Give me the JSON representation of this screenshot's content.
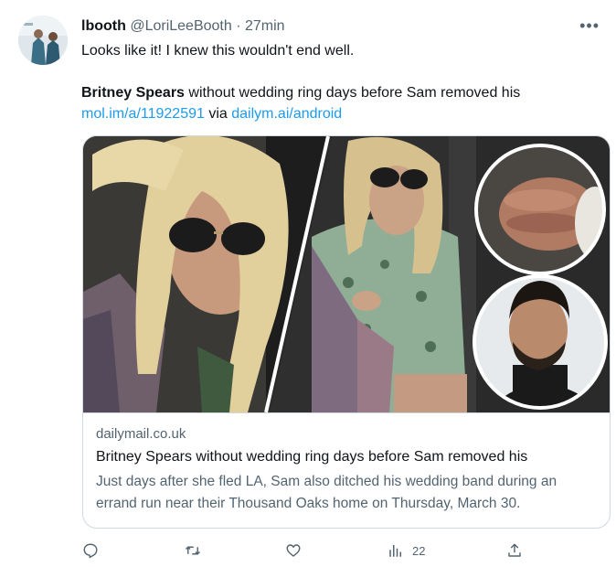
{
  "author": {
    "display_name": "lbooth",
    "handle": "@LoriLeeBooth",
    "separator": "·",
    "time": "27min"
  },
  "tweet": {
    "line1": "Looks like it! I knew this wouldn't end well.",
    "headline_bold": "Britney Spears",
    "headline_rest": " without wedding ring days before Sam removed his",
    "link1": "mol.im/a/11922591",
    "via": " via ",
    "link2": "dailym.ai/android"
  },
  "card": {
    "domain": "dailymail.co.uk",
    "title": "Britney Spears without wedding ring days before Sam removed his",
    "description": "Just days after she fled LA, Sam also ditched his wedding band during an errand run near their Thousand Oaks home on Thursday, March 30."
  },
  "actions": {
    "views": "22"
  },
  "icons": {
    "more": "more-dots-icon",
    "reply": "reply-icon",
    "retweet": "retweet-icon",
    "like": "heart-icon",
    "views": "views-bar-chart-icon",
    "share": "share-icon"
  },
  "colors": {
    "link": "#1d9bf0",
    "muted": "#536471",
    "border": "#cfd9de",
    "text": "#0f1419"
  }
}
